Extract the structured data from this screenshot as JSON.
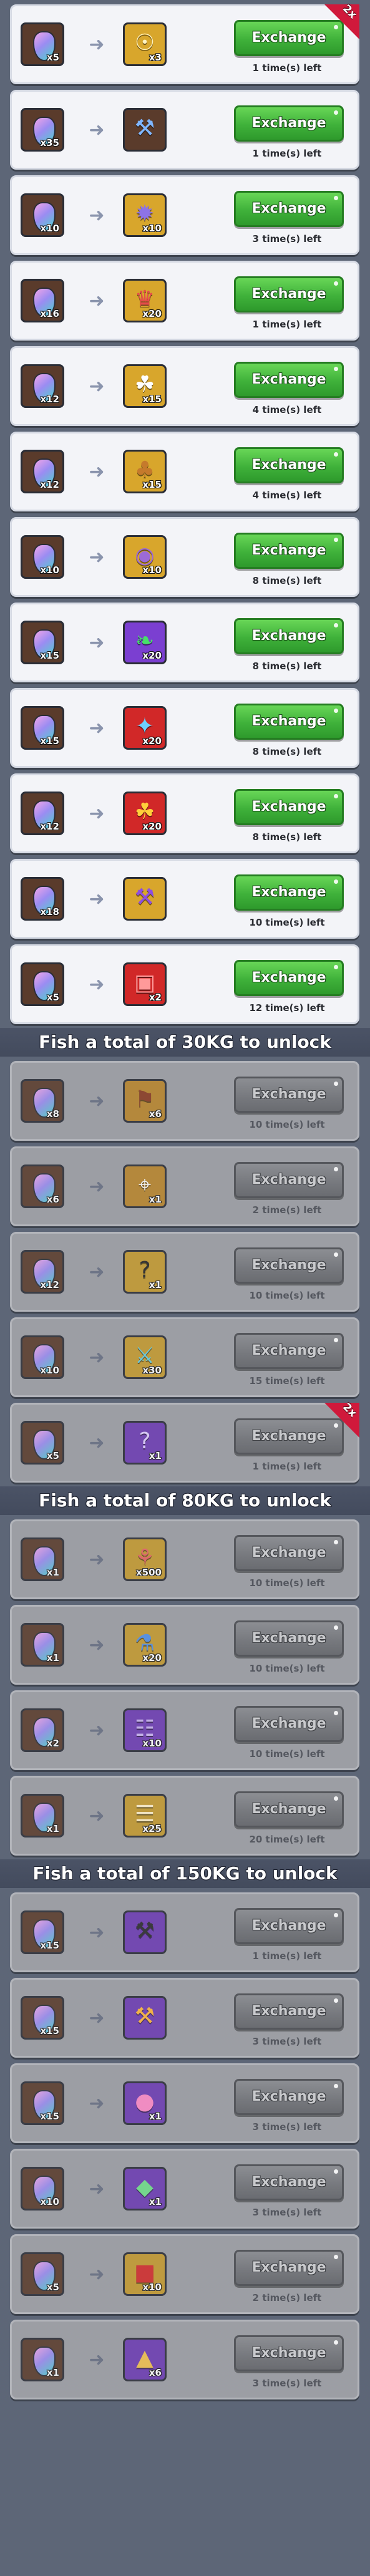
{
  "button_label": "Exchange",
  "badge_label": "2x",
  "colors": {
    "card_bg": "#f3f4f8",
    "locked_bg": "#9c9ea4",
    "button_green": "#3fb13a",
    "button_gray": "#76787d",
    "badge_red": "#d0193b",
    "divider_bg": "#4b5366"
  },
  "groups": [
    {
      "unlock_label": "",
      "items": [
        {
          "cost": "x5",
          "reward": "x3",
          "left": "1 time(s) left",
          "icon": "gold-chest-icon",
          "badge": true
        },
        {
          "cost": "x35",
          "reward": "",
          "left": "1 time(s) left",
          "icon": "fishing-rod-icon"
        },
        {
          "cost": "x10",
          "reward": "x10",
          "left": "3 time(s) left",
          "icon": "spiky-orb-icon"
        },
        {
          "cost": "x16",
          "reward": "x20",
          "left": "1 time(s) left",
          "icon": "hero-shard-icon"
        },
        {
          "cost": "x12",
          "reward": "x15",
          "left": "4 time(s) left",
          "icon": "cat-shard-icon"
        },
        {
          "cost": "x12",
          "reward": "x15",
          "left": "4 time(s) left",
          "icon": "creature-shard-icon"
        },
        {
          "cost": "x10",
          "reward": "x10",
          "left": "8 time(s) left",
          "icon": "mole-shard-icon"
        },
        {
          "cost": "x15",
          "reward": "x20",
          "left": "8 time(s) left",
          "icon": "dragon-shard-icon"
        },
        {
          "cost": "x15",
          "reward": "x20",
          "left": "8 time(s) left",
          "icon": "blue-scroll-icon"
        },
        {
          "cost": "x12",
          "reward": "x20",
          "left": "8 time(s) left",
          "icon": "red-clover-icon"
        },
        {
          "cost": "x18",
          "reward": "",
          "left": "10 time(s) left",
          "icon": "purple-rod-icon"
        },
        {
          "cost": "x5",
          "reward": "x2",
          "left": "12 time(s) left",
          "icon": "red-chest-icon"
        }
      ]
    },
    {
      "unlock_label": "Fish a total of 30KG to unlock",
      "items": [
        {
          "cost": "x8",
          "reward": "x6",
          "left": "10 time(s) left",
          "icon": "map-scroll-icon"
        },
        {
          "cost": "x6",
          "reward": "x1",
          "left": "2 time(s) left",
          "icon": "compass-icon"
        },
        {
          "cost": "x12",
          "reward": "x1",
          "left": "10 time(s) left",
          "icon": "mystery-icon"
        },
        {
          "cost": "x10",
          "reward": "x30",
          "left": "15 time(s) left",
          "icon": "warrior-shard-icon"
        },
        {
          "cost": "x5",
          "reward": "x1",
          "left": "1 time(s) left",
          "icon": "purple-mystery-icon",
          "badge": true
        }
      ]
    },
    {
      "unlock_label": "Fish a total of 80KG to unlock",
      "items": [
        {
          "cost": "x1",
          "reward": "x500",
          "left": "10 time(s) left",
          "icon": "bait-bag-icon"
        },
        {
          "cost": "x1",
          "reward": "x20",
          "left": "10 time(s) left",
          "icon": "potion-icon"
        },
        {
          "cost": "x2",
          "reward": "x10",
          "left": "10 time(s) left",
          "icon": "spell-scroll-icon"
        },
        {
          "cost": "x1",
          "reward": "x25",
          "left": "20 time(s) left",
          "icon": "parchment-icon"
        }
      ]
    },
    {
      "unlock_label": "Fish a total of 150KG to unlock",
      "items": [
        {
          "cost": "x15",
          "reward": "",
          "left": "1 time(s) left",
          "icon": "dark-rod-icon"
        },
        {
          "cost": "x15",
          "reward": "",
          "left": "3 time(s) left",
          "icon": "gold-rod-icon"
        },
        {
          "cost": "x15",
          "reward": "x1",
          "left": "3 time(s) left",
          "icon": "rainbow-orb-icon"
        },
        {
          "cost": "x10",
          "reward": "x1",
          "left": "3 time(s) left",
          "icon": "gem-ball-icon"
        },
        {
          "cost": "x5",
          "reward": "x10",
          "left": "2 time(s) left",
          "icon": "red-box-icon"
        },
        {
          "cost": "x1",
          "reward": "x6",
          "left": "3 time(s) left",
          "icon": "gold-ore-icon"
        }
      ]
    }
  ]
}
